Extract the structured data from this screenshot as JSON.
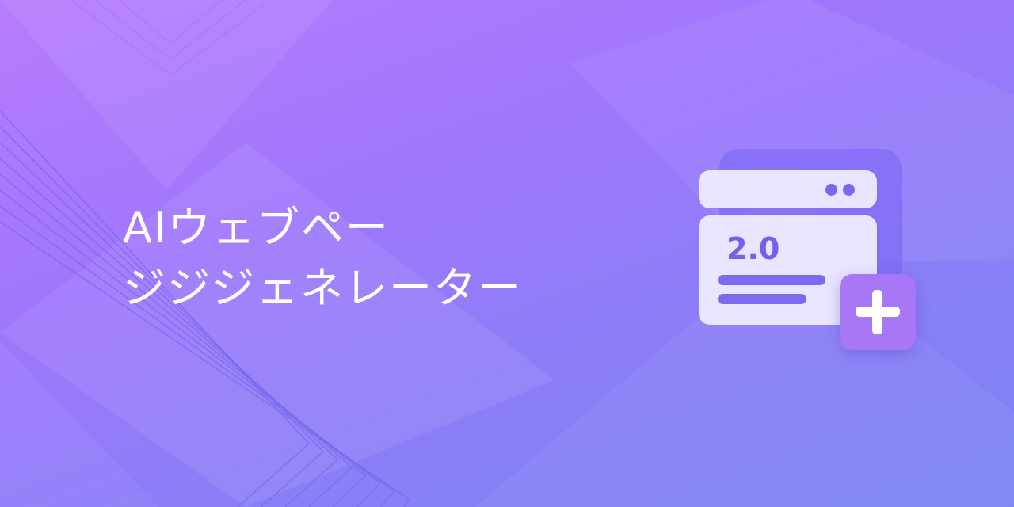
{
  "title": {
    "line1": "AIウェブペー",
    "line2": "ジジジェネレーター"
  },
  "illustration": {
    "version_label": "2.0",
    "icons": [
      "browser-window-icon",
      "plus-icon"
    ]
  },
  "colors": {
    "background_start": "#b67cfb",
    "background_end": "#7b84f3",
    "accent": "#7560ec",
    "plus_tile": "#a877f6"
  }
}
